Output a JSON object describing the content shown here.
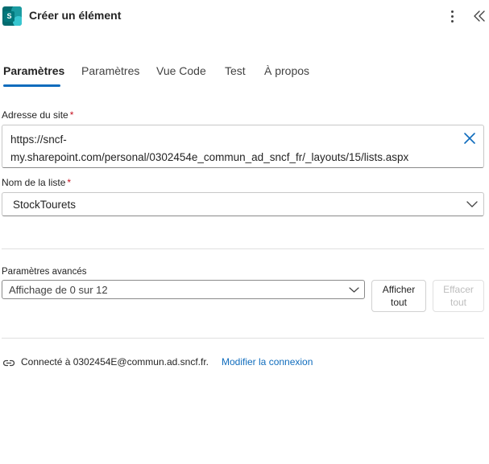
{
  "header": {
    "title": "Créer un élément",
    "app_icon": "sharepoint-icon",
    "more_icon": "more-vertical-icon",
    "collapse_icon": "double-chevron-left-icon"
  },
  "tabs": [
    {
      "label": "Paramètres",
      "active": true
    },
    {
      "label": "Paramètres",
      "active": false
    },
    {
      "label": "Vue Code",
      "active": false
    },
    {
      "label": "Test",
      "active": false
    },
    {
      "label": "À propos",
      "active": false
    }
  ],
  "fields": {
    "site": {
      "label": "Adresse du site",
      "required_mark": "*",
      "value": "https://sncf-my.sharepoint.com/personal/0302454e_commun_ad_sncf_fr/_layouts/15/lists.aspx",
      "value_line1": "https://sncf-",
      "value_line2": "my.sharepoint.com/personal/0302454e_commun_ad_sncf_fr/_layouts/15/lists.aspx"
    },
    "list": {
      "label": "Nom de la liste",
      "required_mark": "*",
      "value": "StockTourets"
    }
  },
  "advanced": {
    "label": "Paramètres avancés",
    "value": "Affichage de 0 sur 12",
    "show_all_line1": "Afficher",
    "show_all_line2": "tout",
    "clear_all_line1": "Effacer",
    "clear_all_line2": "tout"
  },
  "connection": {
    "text": "Connecté à 0302454E@commun.ad.sncf.fr.",
    "link": "Modifier la connexion"
  },
  "colors": {
    "accent": "#0f6cbd",
    "required": "#c50f1f",
    "sharepoint_brand": "#036c70"
  }
}
